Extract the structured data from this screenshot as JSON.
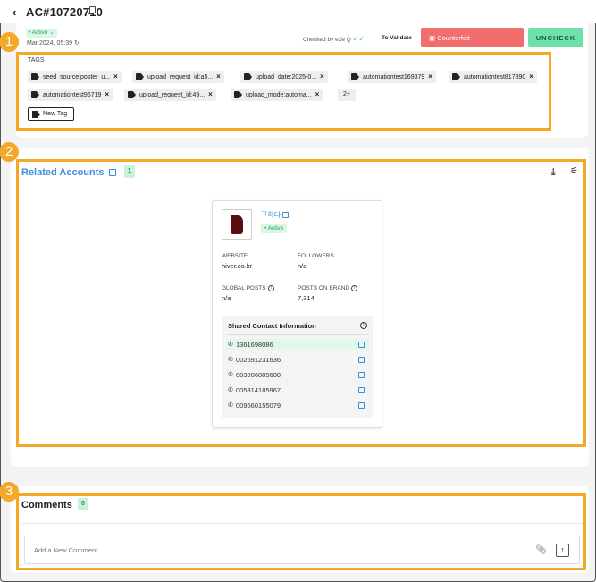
{
  "header": {
    "back_icon": "‹",
    "title": "AC#10720710"
  },
  "top": {
    "status": "• Active ⌄",
    "date": "Mar 2024, 05:39",
    "checked_by": "Checked by e2e Q",
    "validate_label": "To Validate",
    "counterfeit_label": "Counterfeit",
    "uncheck_label": "UNCHECK"
  },
  "tags": {
    "label": "TAGS",
    "items": [
      "seed_source:poster_u...",
      "upload_request_id:a5...",
      "upload_date:2025-0...",
      "automationtest169379",
      "automationtest817890",
      "automationtest96719",
      "upload_request_id:49...",
      "upload_mode:automa..."
    ],
    "more": "2+",
    "new_tag": "New Tag"
  },
  "annotations": [
    "1",
    "2",
    "3"
  ],
  "related": {
    "title": "Related Accounts",
    "count": "1",
    "account": {
      "name": "구하다",
      "status": "• Active",
      "website_label": "WEBSITE",
      "website_value": "hiver.co.kr",
      "followers_label": "FOLLOWERS",
      "followers_value": "n/a",
      "global_posts_label": "GLOBAL POSTS",
      "global_posts_value": "n/a",
      "posts_on_brand_label": "POSTS ON BRAND",
      "posts_on_brand_value": "7,314"
    },
    "shared_title": "Shared Contact Information",
    "phones": [
      "1361698086",
      "002691231636",
      "003906809600",
      "005314185967",
      "009560155079"
    ]
  },
  "comments": {
    "title": "Comments",
    "count": "0",
    "placeholder": "Add a New Comment"
  },
  "colors": {
    "annotation": "#f3a827",
    "counterfeit": "#f26d6d",
    "uncheck": "#6fe0a8",
    "link": "#3a8fd9"
  }
}
